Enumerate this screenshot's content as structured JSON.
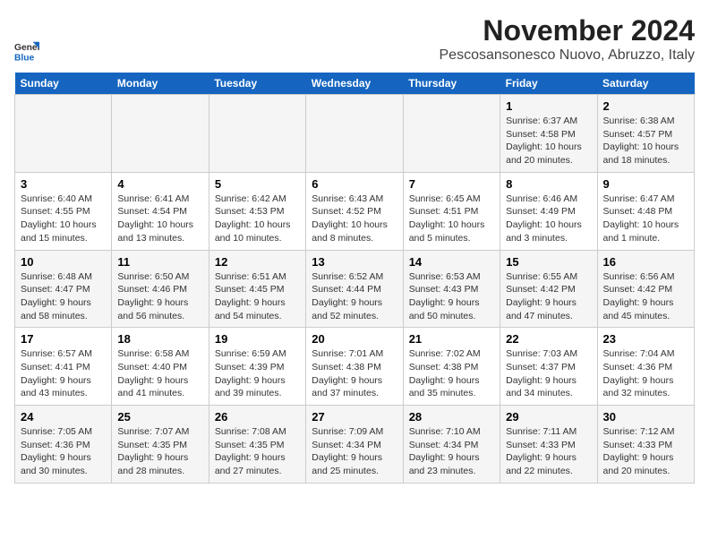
{
  "header": {
    "logo_line1": "General",
    "logo_line2": "Blue",
    "month": "November 2024",
    "location": "Pescosansonesco Nuovo, Abruzzo, Italy"
  },
  "weekdays": [
    "Sunday",
    "Monday",
    "Tuesday",
    "Wednesday",
    "Thursday",
    "Friday",
    "Saturday"
  ],
  "weeks": [
    [
      {
        "day": "",
        "info": ""
      },
      {
        "day": "",
        "info": ""
      },
      {
        "day": "",
        "info": ""
      },
      {
        "day": "",
        "info": ""
      },
      {
        "day": "",
        "info": ""
      },
      {
        "day": "1",
        "info": "Sunrise: 6:37 AM\nSunset: 4:58 PM\nDaylight: 10 hours and 20 minutes."
      },
      {
        "day": "2",
        "info": "Sunrise: 6:38 AM\nSunset: 4:57 PM\nDaylight: 10 hours and 18 minutes."
      }
    ],
    [
      {
        "day": "3",
        "info": "Sunrise: 6:40 AM\nSunset: 4:55 PM\nDaylight: 10 hours and 15 minutes."
      },
      {
        "day": "4",
        "info": "Sunrise: 6:41 AM\nSunset: 4:54 PM\nDaylight: 10 hours and 13 minutes."
      },
      {
        "day": "5",
        "info": "Sunrise: 6:42 AM\nSunset: 4:53 PM\nDaylight: 10 hours and 10 minutes."
      },
      {
        "day": "6",
        "info": "Sunrise: 6:43 AM\nSunset: 4:52 PM\nDaylight: 10 hours and 8 minutes."
      },
      {
        "day": "7",
        "info": "Sunrise: 6:45 AM\nSunset: 4:51 PM\nDaylight: 10 hours and 5 minutes."
      },
      {
        "day": "8",
        "info": "Sunrise: 6:46 AM\nSunset: 4:49 PM\nDaylight: 10 hours and 3 minutes."
      },
      {
        "day": "9",
        "info": "Sunrise: 6:47 AM\nSunset: 4:48 PM\nDaylight: 10 hours and 1 minute."
      }
    ],
    [
      {
        "day": "10",
        "info": "Sunrise: 6:48 AM\nSunset: 4:47 PM\nDaylight: 9 hours and 58 minutes."
      },
      {
        "day": "11",
        "info": "Sunrise: 6:50 AM\nSunset: 4:46 PM\nDaylight: 9 hours and 56 minutes."
      },
      {
        "day": "12",
        "info": "Sunrise: 6:51 AM\nSunset: 4:45 PM\nDaylight: 9 hours and 54 minutes."
      },
      {
        "day": "13",
        "info": "Sunrise: 6:52 AM\nSunset: 4:44 PM\nDaylight: 9 hours and 52 minutes."
      },
      {
        "day": "14",
        "info": "Sunrise: 6:53 AM\nSunset: 4:43 PM\nDaylight: 9 hours and 50 minutes."
      },
      {
        "day": "15",
        "info": "Sunrise: 6:55 AM\nSunset: 4:42 PM\nDaylight: 9 hours and 47 minutes."
      },
      {
        "day": "16",
        "info": "Sunrise: 6:56 AM\nSunset: 4:42 PM\nDaylight: 9 hours and 45 minutes."
      }
    ],
    [
      {
        "day": "17",
        "info": "Sunrise: 6:57 AM\nSunset: 4:41 PM\nDaylight: 9 hours and 43 minutes."
      },
      {
        "day": "18",
        "info": "Sunrise: 6:58 AM\nSunset: 4:40 PM\nDaylight: 9 hours and 41 minutes."
      },
      {
        "day": "19",
        "info": "Sunrise: 6:59 AM\nSunset: 4:39 PM\nDaylight: 9 hours and 39 minutes."
      },
      {
        "day": "20",
        "info": "Sunrise: 7:01 AM\nSunset: 4:38 PM\nDaylight: 9 hours and 37 minutes."
      },
      {
        "day": "21",
        "info": "Sunrise: 7:02 AM\nSunset: 4:38 PM\nDaylight: 9 hours and 35 minutes."
      },
      {
        "day": "22",
        "info": "Sunrise: 7:03 AM\nSunset: 4:37 PM\nDaylight: 9 hours and 34 minutes."
      },
      {
        "day": "23",
        "info": "Sunrise: 7:04 AM\nSunset: 4:36 PM\nDaylight: 9 hours and 32 minutes."
      }
    ],
    [
      {
        "day": "24",
        "info": "Sunrise: 7:05 AM\nSunset: 4:36 PM\nDaylight: 9 hours and 30 minutes."
      },
      {
        "day": "25",
        "info": "Sunrise: 7:07 AM\nSunset: 4:35 PM\nDaylight: 9 hours and 28 minutes."
      },
      {
        "day": "26",
        "info": "Sunrise: 7:08 AM\nSunset: 4:35 PM\nDaylight: 9 hours and 27 minutes."
      },
      {
        "day": "27",
        "info": "Sunrise: 7:09 AM\nSunset: 4:34 PM\nDaylight: 9 hours and 25 minutes."
      },
      {
        "day": "28",
        "info": "Sunrise: 7:10 AM\nSunset: 4:34 PM\nDaylight: 9 hours and 23 minutes."
      },
      {
        "day": "29",
        "info": "Sunrise: 7:11 AM\nSunset: 4:33 PM\nDaylight: 9 hours and 22 minutes."
      },
      {
        "day": "30",
        "info": "Sunrise: 7:12 AM\nSunset: 4:33 PM\nDaylight: 9 hours and 20 minutes."
      }
    ]
  ]
}
